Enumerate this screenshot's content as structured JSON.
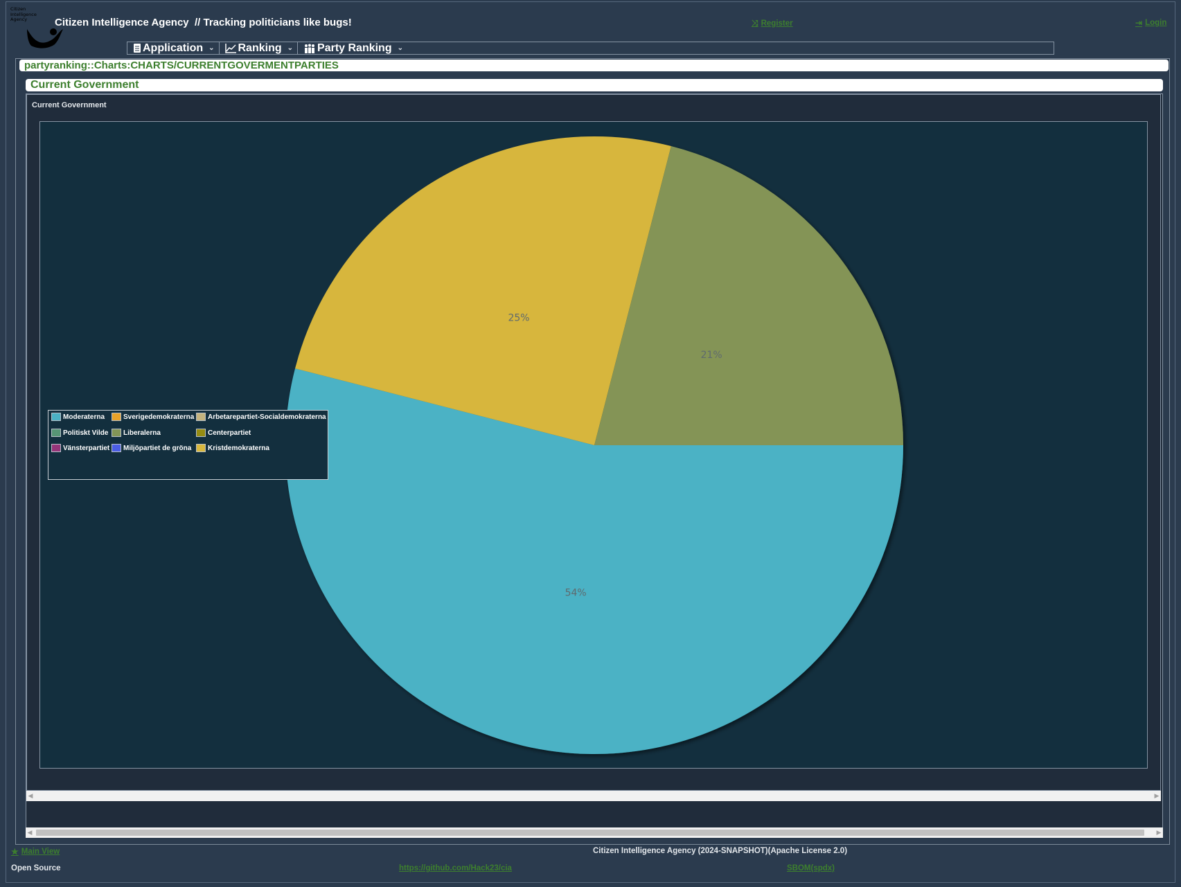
{
  "header": {
    "logo_text": "Citizen\nIntelligence\nAgency",
    "app_title": "Citizen Intelligence Agency  // Tracking politicians like bugs!",
    "register_label": "Register",
    "login_label": "Login"
  },
  "menu": {
    "items": [
      {
        "label": "Application",
        "icon": "document-icon"
      },
      {
        "label": "Ranking",
        "icon": "line-chart-icon"
      },
      {
        "label": "Party Ranking",
        "icon": "group-icon"
      }
    ]
  },
  "breadcrumb": "partyranking::Charts:CHARTS/CURRENTGOVERMENTPARTIES",
  "panel": {
    "caption": "Current Government",
    "chart_caption": "Current Government"
  },
  "chart_data": {
    "type": "pie",
    "title": "Current Government",
    "categories": [
      "Moderaterna",
      "Kristdemokraterna",
      "Liberalerna"
    ],
    "values": [
      54,
      25,
      21
    ],
    "colors": [
      "#4bb2c5",
      "#d7b63c",
      "#849457"
    ],
    "labels": [
      "54%",
      "25%",
      "21%"
    ],
    "legend_placement": "left",
    "legend": [
      {
        "name": "Moderaterna",
        "color": "#4bb2c5"
      },
      {
        "name": "Sverigedemokraterna",
        "color": "#eaa228"
      },
      {
        "name": "Arbetarepartiet-Socialdemokraterna",
        "color": "#c5b47f"
      },
      {
        "name": "Politiskt Vilde",
        "color": "#579575"
      },
      {
        "name": "Liberalerna",
        "color": "#839557"
      },
      {
        "name": "Centerpartiet",
        "color": "#958c12"
      },
      {
        "name": "Vänsterpartiet",
        "color": "#953579"
      },
      {
        "name": "Miljöpartiet de gröna",
        "color": "#4b5de4"
      },
      {
        "name": "Kristdemokraterna",
        "color": "#d8b83f"
      }
    ]
  },
  "footer": {
    "main_view_label": "Main View",
    "version_text": "Citizen Intelligence Agency (2024-SNAPSHOT)(Apache License 2.0)",
    "open_source_label": "Open Source",
    "github_link": "https://github.com/Hack23/cia",
    "sbom_link": "SBOM(spdx)"
  }
}
